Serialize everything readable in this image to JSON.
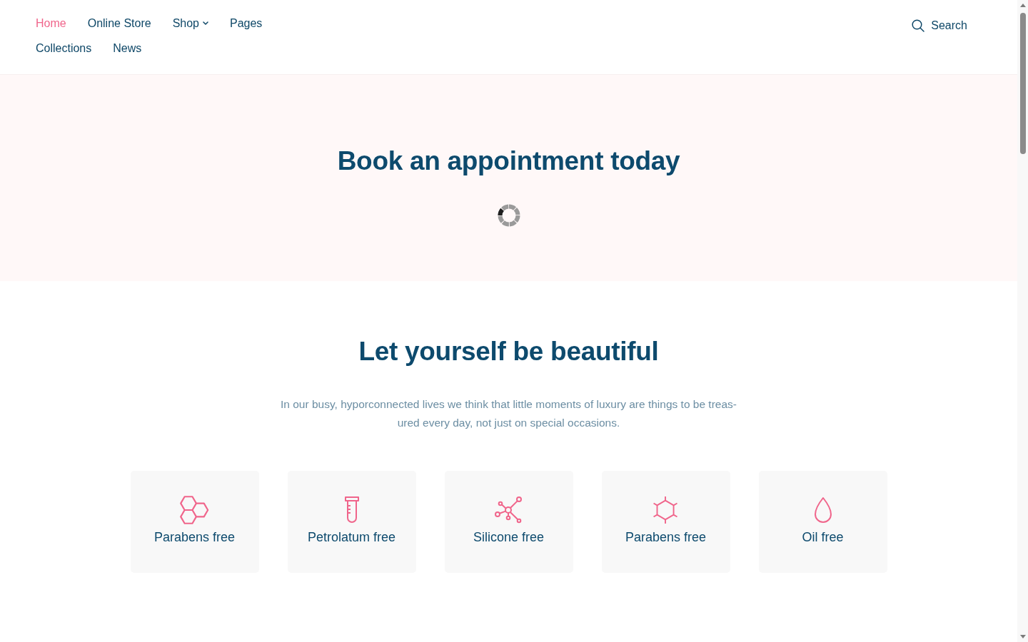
{
  "header": {
    "nav": [
      {
        "label": "Home",
        "selected": true,
        "kind": "link"
      },
      {
        "label": "Online Store",
        "selected": false,
        "kind": "link"
      },
      {
        "label": "Shop",
        "selected": false,
        "kind": "dropdown"
      },
      {
        "label": "Pages",
        "selected": false,
        "kind": "link"
      },
      {
        "label": "Collections",
        "selected": false,
        "kind": "link"
      },
      {
        "label": "News",
        "selected": false,
        "kind": "link"
      }
    ],
    "search": {
      "label": "Search"
    }
  },
  "hero": {
    "title": "Book an appointment today"
  },
  "features": {
    "title": "Let yourself be beautiful",
    "text": "In our busy, hyporconnected lives we think that little moments of luxury are things to be treas-\nured every day, not just on special occasions.",
    "items": [
      {
        "label": "Parabens free"
      },
      {
        "label": "Petrolatum free"
      },
      {
        "label": "Silicone free"
      },
      {
        "label": "Parabens free"
      },
      {
        "label": "Oil free"
      }
    ]
  }
}
